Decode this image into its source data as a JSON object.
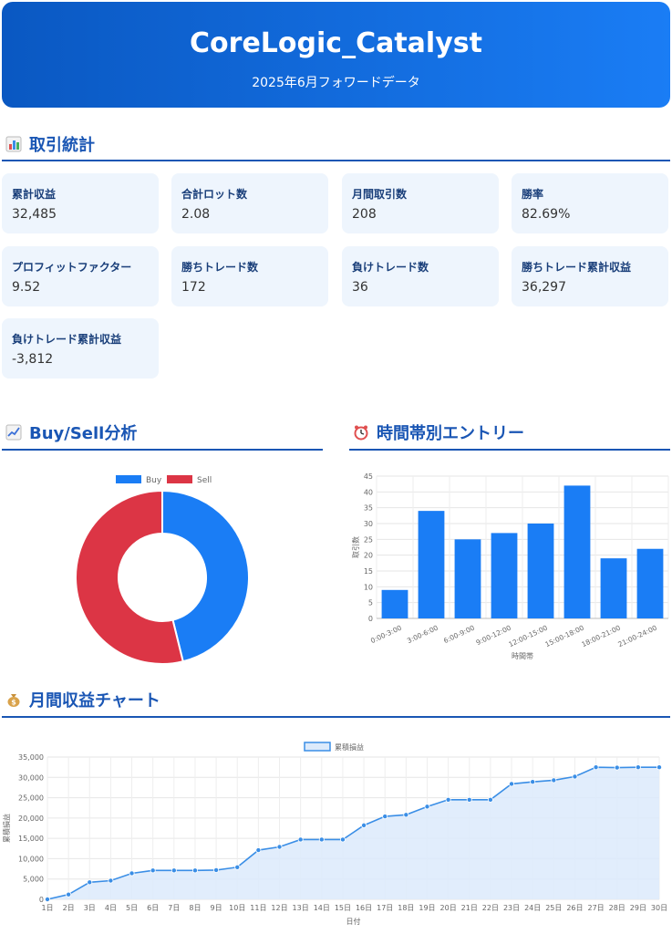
{
  "header": {
    "title": "CoreLogic_Catalyst",
    "subtitle": "2025年6月フォワードデータ"
  },
  "sections": {
    "stats": "取引統計",
    "buysell": "Buy/Sell分析",
    "time": "時間帯別エントリー",
    "monthly": "月間収益チャート"
  },
  "stats": [
    {
      "label": "累計収益",
      "value": "32,485"
    },
    {
      "label": "合計ロット数",
      "value": "2.08"
    },
    {
      "label": "月間取引数",
      "value": "208"
    },
    {
      "label": "勝率",
      "value": "82.69%"
    },
    {
      "label": "プロフィットファクター",
      "value": "9.52"
    },
    {
      "label": "勝ちトレード数",
      "value": "172"
    },
    {
      "label": "負けトレード数",
      "value": "36"
    },
    {
      "label": "勝ちトレード累計収益",
      "value": "36,297"
    },
    {
      "label": "負けトレード累計収益",
      "value": "-3,812"
    }
  ],
  "colors": {
    "accent": "#1a56b4",
    "buy": "#1a7df5",
    "sell": "#dc3545",
    "bar": "#1a7df5",
    "line": "#3a8ee6",
    "area": "#dceafb"
  },
  "icons": {
    "stats": "bar-chart-icon",
    "buysell": "trend-chart-icon",
    "time": "alarm-clock-icon",
    "monthly": "money-bag-icon"
  },
  "chart_data": [
    {
      "type": "pie",
      "subtype": "doughnut",
      "legend": "top",
      "labels": [
        "Buy",
        "Sell"
      ],
      "values": [
        96,
        112
      ]
    },
    {
      "type": "bar",
      "categories": [
        "0:00-3:00",
        "3:00-6:00",
        "6:00-9:00",
        "9:00-12:00",
        "12:00-15:00",
        "15:00-18:00",
        "18:00-21:00",
        "21:00-24:00"
      ],
      "values": [
        9,
        34,
        25,
        27,
        30,
        42,
        19,
        22
      ],
      "xlabel": "時間帯",
      "ylabel": "取引数",
      "ylim": [
        0,
        45
      ],
      "yticks": [
        0,
        5,
        10,
        15,
        20,
        25,
        30,
        35,
        40,
        45
      ],
      "grid": true
    },
    {
      "type": "area",
      "legend": "top",
      "series": [
        {
          "name": "累積損益",
          "values": [
            0,
            1200,
            4200,
            4600,
            6400,
            7100,
            7100,
            7100,
            7200,
            7900,
            12100,
            12900,
            14700,
            14700,
            14700,
            18200,
            20400,
            20800,
            22800,
            24500,
            24500,
            24500,
            28400,
            28900,
            29300,
            30200,
            32500,
            32400,
            32500,
            32485
          ]
        }
      ],
      "categories": [
        "1日",
        "2日",
        "3日",
        "4日",
        "5日",
        "6日",
        "7日",
        "8日",
        "9日",
        "10日",
        "11日",
        "12日",
        "13日",
        "14日",
        "15日",
        "16日",
        "17日",
        "18日",
        "19日",
        "20日",
        "21日",
        "22日",
        "23日",
        "24日",
        "25日",
        "26日",
        "27日",
        "28日",
        "29日",
        "30日"
      ],
      "xlabel": "日付",
      "ylabel": "累積損益",
      "ylim": [
        0,
        35000
      ],
      "yticks": [
        0,
        5000,
        10000,
        15000,
        20000,
        25000,
        30000,
        35000
      ],
      "yticklabels": [
        "0",
        "5,000",
        "10,000",
        "15,000",
        "20,000",
        "25,000",
        "30,000",
        "35,000"
      ],
      "grid": true
    }
  ]
}
